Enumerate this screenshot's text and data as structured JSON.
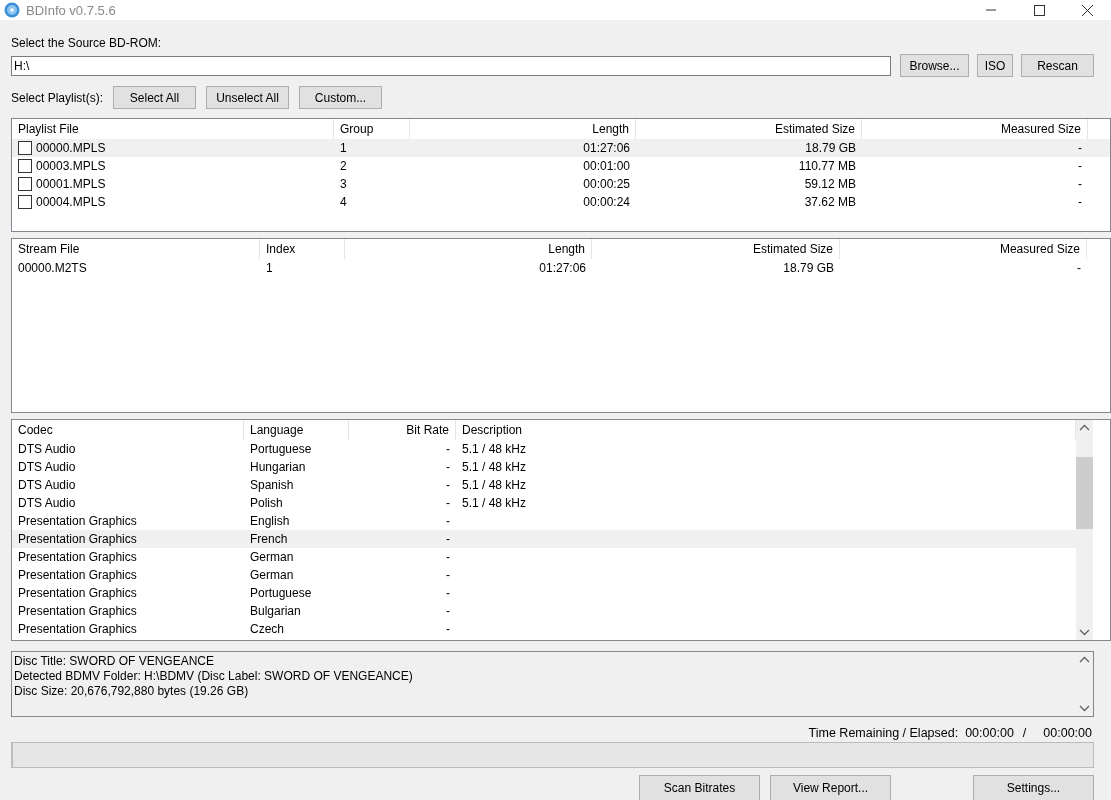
{
  "window": {
    "title": "BDInfo v0.7.5.6"
  },
  "source": {
    "label": "Select the Source BD-ROM:",
    "value": "H:\\",
    "buttons": [
      "Browse...",
      "ISO",
      "Rescan"
    ]
  },
  "playlist_selection": {
    "label": "Select Playlist(s):",
    "buttons": [
      "Select All",
      "Unselect All",
      "Custom..."
    ]
  },
  "playlist_table": {
    "columns": [
      "Playlist File",
      "Group",
      "Length",
      "Estimated Size",
      "Measured Size"
    ],
    "rows": [
      {
        "cells": [
          "00000.MPLS",
          "1",
          "01:27:06",
          "18.79 GB",
          "-"
        ],
        "checked": false,
        "selected": true
      },
      {
        "cells": [
          "00003.MPLS",
          "2",
          "00:01:00",
          "110.77 MB",
          "-"
        ],
        "checked": false,
        "selected": false
      },
      {
        "cells": [
          "00001.MPLS",
          "3",
          "00:00:25",
          "59.12 MB",
          "-"
        ],
        "checked": false,
        "selected": false
      },
      {
        "cells": [
          "00004.MPLS",
          "4",
          "00:00:24",
          "37.62 MB",
          "-"
        ],
        "checked": false,
        "selected": false
      }
    ]
  },
  "stream_table": {
    "columns": [
      "Stream File",
      "Index",
      "Length",
      "Estimated Size",
      "Measured Size"
    ],
    "rows": [
      {
        "cells": [
          "00000.M2TS",
          "1",
          "01:27:06",
          "18.79 GB",
          "-"
        ],
        "selected": false
      }
    ]
  },
  "codec_table": {
    "columns": [
      "Codec",
      "Language",
      "Bit Rate",
      "Description"
    ],
    "rows": [
      {
        "cells": [
          "DTS Audio",
          "Portuguese",
          "-",
          "5.1 / 48 kHz"
        ],
        "selected": false
      },
      {
        "cells": [
          "DTS Audio",
          "Hungarian",
          "-",
          "5.1 / 48 kHz"
        ],
        "selected": false
      },
      {
        "cells": [
          "DTS Audio",
          "Spanish",
          "-",
          "5.1 / 48 kHz"
        ],
        "selected": false
      },
      {
        "cells": [
          "DTS Audio",
          "Polish",
          "-",
          "5.1 / 48 kHz"
        ],
        "selected": false
      },
      {
        "cells": [
          "Presentation Graphics",
          "English",
          "-"
        ],
        "selected": false
      },
      {
        "cells": [
          "Presentation Graphics",
          "French",
          "-"
        ],
        "selected": true
      },
      {
        "cells": [
          "Presentation Graphics",
          "German",
          "-"
        ],
        "selected": false
      },
      {
        "cells": [
          "Presentation Graphics",
          "German",
          "-"
        ],
        "selected": false
      },
      {
        "cells": [
          "Presentation Graphics",
          "Portuguese",
          "-"
        ],
        "selected": false
      },
      {
        "cells": [
          "Presentation Graphics",
          "Bulgarian",
          "-"
        ],
        "selected": false
      },
      {
        "cells": [
          "Presentation Graphics",
          "Czech",
          "-"
        ],
        "selected": false
      }
    ]
  },
  "disc_info": [
    "Disc Title: SWORD OF VENGEANCE",
    "Detected BDMV Folder: H:\\BDMV (Disc Label: SWORD OF VENGEANCE)",
    "Disc Size: 20,676,792,880 bytes (19.26 GB)"
  ],
  "time": {
    "label": "Time Remaining / Elapsed:",
    "remaining": "00:00:00",
    "separator": "/",
    "elapsed": "00:00:00"
  },
  "progress": {
    "level": 0
  },
  "actions": [
    "Scan Bitrates",
    "View Report...",
    "Settings..."
  ]
}
